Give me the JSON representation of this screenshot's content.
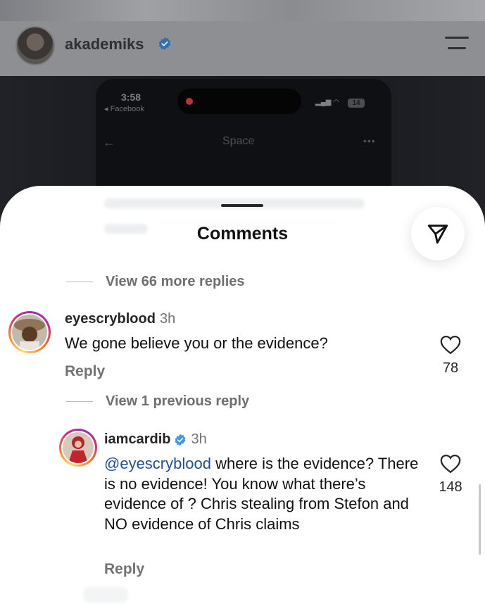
{
  "post": {
    "username": "akademiks"
  },
  "phone": {
    "time": "3:58",
    "back_label": "◂ Facebook",
    "battery": "14",
    "nav_title": "Space"
  },
  "sheet": {
    "title": "Comments"
  },
  "view_more_replies": "View 66 more replies",
  "comments": [
    {
      "username": "eyescryblood",
      "time": "3h",
      "text": "We gone believe you or the evidence?",
      "reply_label": "Reply",
      "likes": "78"
    }
  ],
  "view_previous_reply": "View 1 previous reply",
  "replies": [
    {
      "username": "iamcardib",
      "verified": true,
      "time": "3h",
      "mention": "@eyescryblood",
      "text": "where is the evidence? There is no evidence! You know what there’s evidence of ? Chris stealing from Stefon and NO evidence of Chris claims",
      "reply_label": "Reply",
      "likes": "148"
    }
  ],
  "colors": {
    "verified": "#3897f0",
    "mention": "#1f4e9c",
    "muted": "#737373"
  }
}
